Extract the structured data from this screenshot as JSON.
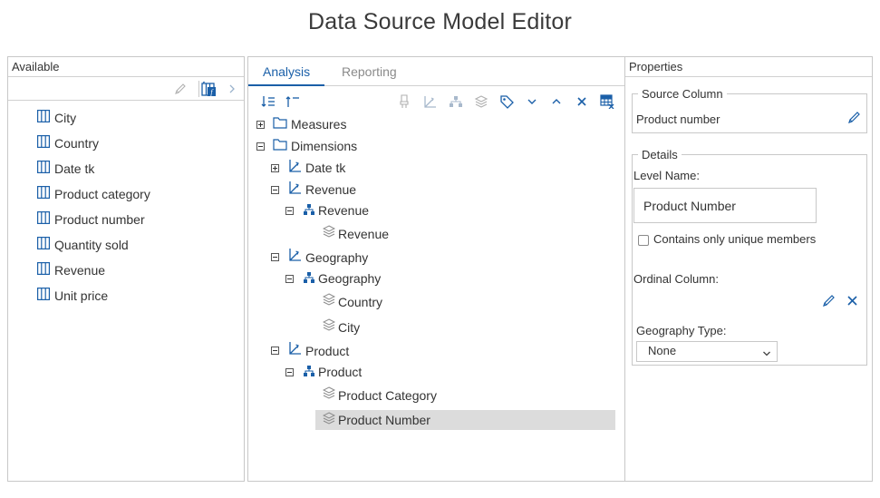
{
  "page": {
    "title": "Data Source Model Editor"
  },
  "available": {
    "header": "Available",
    "fields": [
      "City",
      "Country",
      "Date tk",
      "Product category",
      "Product number",
      "Quantity sold",
      "Revenue",
      "Unit price"
    ]
  },
  "analysis": {
    "tabs": [
      {
        "label": "Analysis",
        "active": true
      },
      {
        "label": "Reporting",
        "active": false
      }
    ],
    "tree": {
      "measures": "Measures",
      "dimensions": "Dimensions",
      "date_tk": "Date tk",
      "revenue_dim": "Revenue",
      "revenue_hier": "Revenue",
      "revenue_level": "Revenue",
      "geography_dim": "Geography",
      "geography_hier": "Geography",
      "country_level": "Country",
      "city_level": "City",
      "product_dim": "Product",
      "product_hier": "Product",
      "product_category_level": "Product Category",
      "product_number_level": "Product Number"
    }
  },
  "properties": {
    "header": "Properties",
    "source_column": {
      "legend": "Source Column",
      "value": "Product number"
    },
    "details": {
      "legend": "Details",
      "level_name_label": "Level Name:",
      "level_name_value": "Product Number",
      "unique_members_label": "Contains only unique members",
      "unique_members_checked": false,
      "ordinal_column_label": "Ordinal Column:",
      "geography_type_label": "Geography Type:",
      "geography_type_value": "None"
    }
  },
  "colors": {
    "accent": "#1a5fa8",
    "selection": "#dcdcdc",
    "border": "#c8c8c8"
  }
}
